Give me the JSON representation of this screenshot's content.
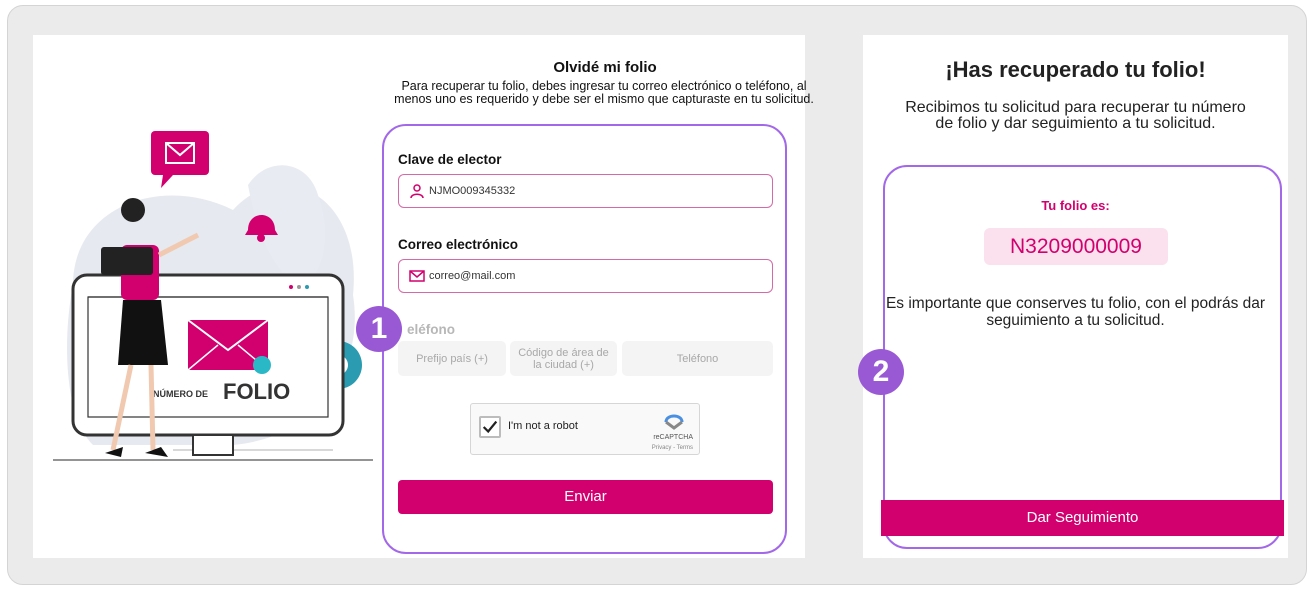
{
  "form": {
    "title": "Olvidé mi folio",
    "description": "Para recuperar tu folio, debes ingresar tu correo electrónico o teléfono, al menos uno es requerido y debe ser el mismo que capturaste en tu solicitud.",
    "clave_label": "Clave de elector",
    "clave_value": "NJMO009345332",
    "email_label": "Correo electrónico",
    "email_value": "correo@mail.com",
    "phone_label": "eléfono",
    "phone_prefix_placeholder": "Prefijo país (+)",
    "phone_area_placeholder": "Código de área de la ciudad (+)",
    "phone_number_placeholder": "Teléfono",
    "captcha_label": "I'm not a robot",
    "captcha_brand": "reCAPTCHA",
    "captcha_links": "Privacy - Terms",
    "submit_label": "Enviar"
  },
  "illustration": {
    "label_small": "NÚMERO DE",
    "label_big": "FOLIO"
  },
  "steps": [
    "1",
    "2"
  ],
  "result": {
    "title": "¡Has recuperado tu folio!",
    "description": "Recibimos tu solicitud para recuperar tu número de folio y dar seguimiento a tu solicitud.",
    "folio_label": "Tu folio es:",
    "folio_value": "N3209000009",
    "note": "Es importante que conserves tu folio, con el podrás dar seguimiento a tu solicitud.",
    "button_label": "Dar Seguimiento"
  },
  "colors": {
    "brand": "#d2006f",
    "highlight": "#a268e8",
    "step": "#9a59d4"
  }
}
